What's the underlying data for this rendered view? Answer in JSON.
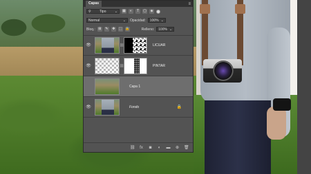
{
  "panel": {
    "tab_label": "Capas",
    "menu_icon": "hamburger-menu-icon",
    "filter_label": "Tipo",
    "blend_mode": "Normal",
    "opacity_label": "Opacidad:",
    "opacity_value": "100%",
    "lock_label": "Bloq.:",
    "fill_label": "Relleno:",
    "fill_value": "100%"
  },
  "layers": [
    {
      "name": "LICUAR",
      "visible": true,
      "has_mask": true,
      "mask": "black",
      "selected": false
    },
    {
      "name": "PINTAR",
      "visible": true,
      "has_mask": true,
      "mask": "white",
      "selected": false
    },
    {
      "name": "Capa 1",
      "visible": false,
      "has_mask": false,
      "selected": true
    },
    {
      "name": "Fondo",
      "visible": true,
      "has_mask": false,
      "locked": true,
      "selected": false
    }
  ],
  "footer_icons": [
    "link-icon",
    "fx-icon",
    "mask-icon",
    "adjustment-icon",
    "folder-icon",
    "new-layer-icon",
    "trash-icon"
  ]
}
